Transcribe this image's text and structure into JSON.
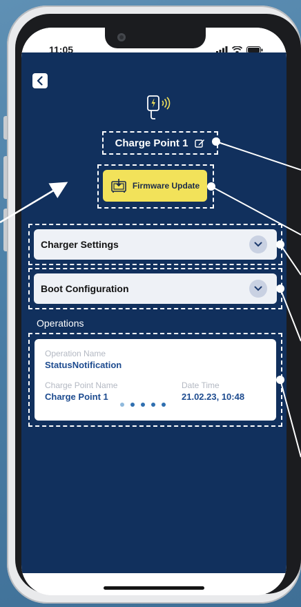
{
  "status_bar": {
    "time": "11:05"
  },
  "header": {
    "charger_name": "Charge Point 1"
  },
  "actions": {
    "firmware_update_label": "Firmware Update"
  },
  "sections": [
    {
      "label": "Charger Settings",
      "expanded": false
    },
    {
      "label": "Boot Configuration",
      "expanded": false
    }
  ],
  "operations": {
    "heading": "Operations",
    "card": {
      "operation_name_label": "Operation Name",
      "operation_name": "StatusNotification",
      "charge_point_label": "Charge Point Name",
      "charge_point": "Charge Point 1",
      "date_time_label": "Date Time",
      "date_time": "21.02.23, 10:48"
    },
    "pagination": {
      "total": 5,
      "active_index": 0
    }
  },
  "colors": {
    "app_background": "#11305d",
    "firmware_button": "#f2e25a",
    "accent_text": "#1d4b8f",
    "accordion_background": "#eef1f6"
  },
  "icons": [
    "chevron-left-icon",
    "charger-nfc-icon",
    "edit-icon",
    "firmware-update-icon",
    "chevron-down-icon"
  ]
}
